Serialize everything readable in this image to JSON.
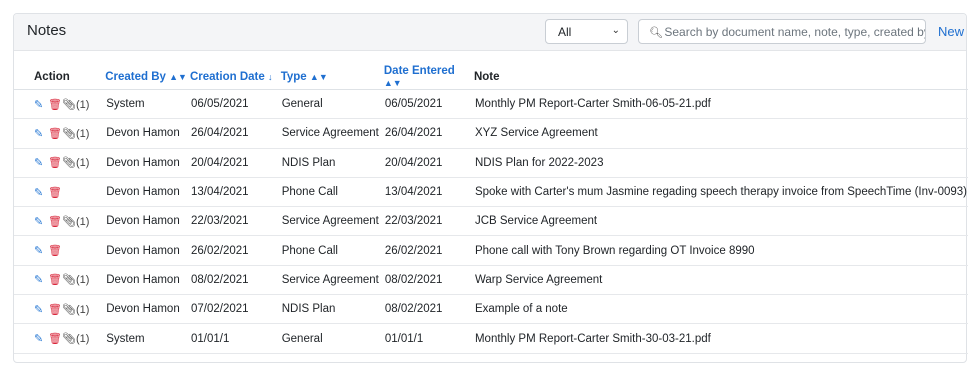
{
  "panel": {
    "title": "Notes",
    "filter": {
      "selected": "All"
    },
    "search": {
      "placeholder": "Search by document name, note, type, created by"
    },
    "new_label": "New"
  },
  "columns": {
    "action": "Action",
    "created_by": "Created By",
    "creation_date": "Creation Date",
    "type": "Type",
    "date_entered": "Date Entered",
    "note": "Note"
  },
  "icons": {
    "edit": "edit-icon",
    "delete": "trash-icon",
    "attachment": "paperclip-icon",
    "sort": "sort-icon",
    "search": "search-icon",
    "chevron": "chevron-down-icon"
  },
  "colors": {
    "link": "#1f6fd0",
    "delete": "#d9263a"
  },
  "rows": [
    {
      "attach": "(1)",
      "created_by": "System",
      "creation_date": "06/05/2021",
      "type": "General",
      "date_entered": "06/05/2021",
      "note": "Monthly PM Report-Carter Smith-06-05-21.pdf"
    },
    {
      "attach": "(1)",
      "created_by": "Devon Hamon",
      "creation_date": "26/04/2021",
      "type": "Service Agreement",
      "date_entered": "26/04/2021",
      "note": "XYZ Service Agreement"
    },
    {
      "attach": "(1)",
      "created_by": "Devon Hamon",
      "creation_date": "20/04/2021",
      "type": "NDIS Plan",
      "date_entered": "20/04/2021",
      "note": "NDIS Plan for 2022-2023"
    },
    {
      "attach": "",
      "created_by": "Devon Hamon",
      "creation_date": "13/04/2021",
      "type": "Phone Call",
      "date_entered": "13/04/2021",
      "note": "Spoke with Carter's mum Jasmine regading speech therapy invoice from SpeechTime (Inv-0093)"
    },
    {
      "attach": "(1)",
      "created_by": "Devon Hamon",
      "creation_date": "22/03/2021",
      "type": "Service Agreement",
      "date_entered": "22/03/2021",
      "note": "JCB Service Agreement"
    },
    {
      "attach": "",
      "created_by": "Devon Hamon",
      "creation_date": "26/02/2021",
      "type": "Phone Call",
      "date_entered": "26/02/2021",
      "note": "Phone call with Tony Brown regarding OT Invoice 8990"
    },
    {
      "attach": "(1)",
      "created_by": "Devon Hamon",
      "creation_date": "08/02/2021",
      "type": "Service Agreement",
      "date_entered": "08/02/2021",
      "note": "Warp Service Agreement"
    },
    {
      "attach": "(1)",
      "created_by": "Devon Hamon",
      "creation_date": "07/02/2021",
      "type": "NDIS Plan",
      "date_entered": "08/02/2021",
      "note": "Example of a note"
    },
    {
      "attach": "(1)",
      "created_by": "System",
      "creation_date": "01/01/1",
      "type": "General",
      "date_entered": "01/01/1",
      "note": "Monthly PM Report-Carter Smith-30-03-21.pdf"
    }
  ]
}
